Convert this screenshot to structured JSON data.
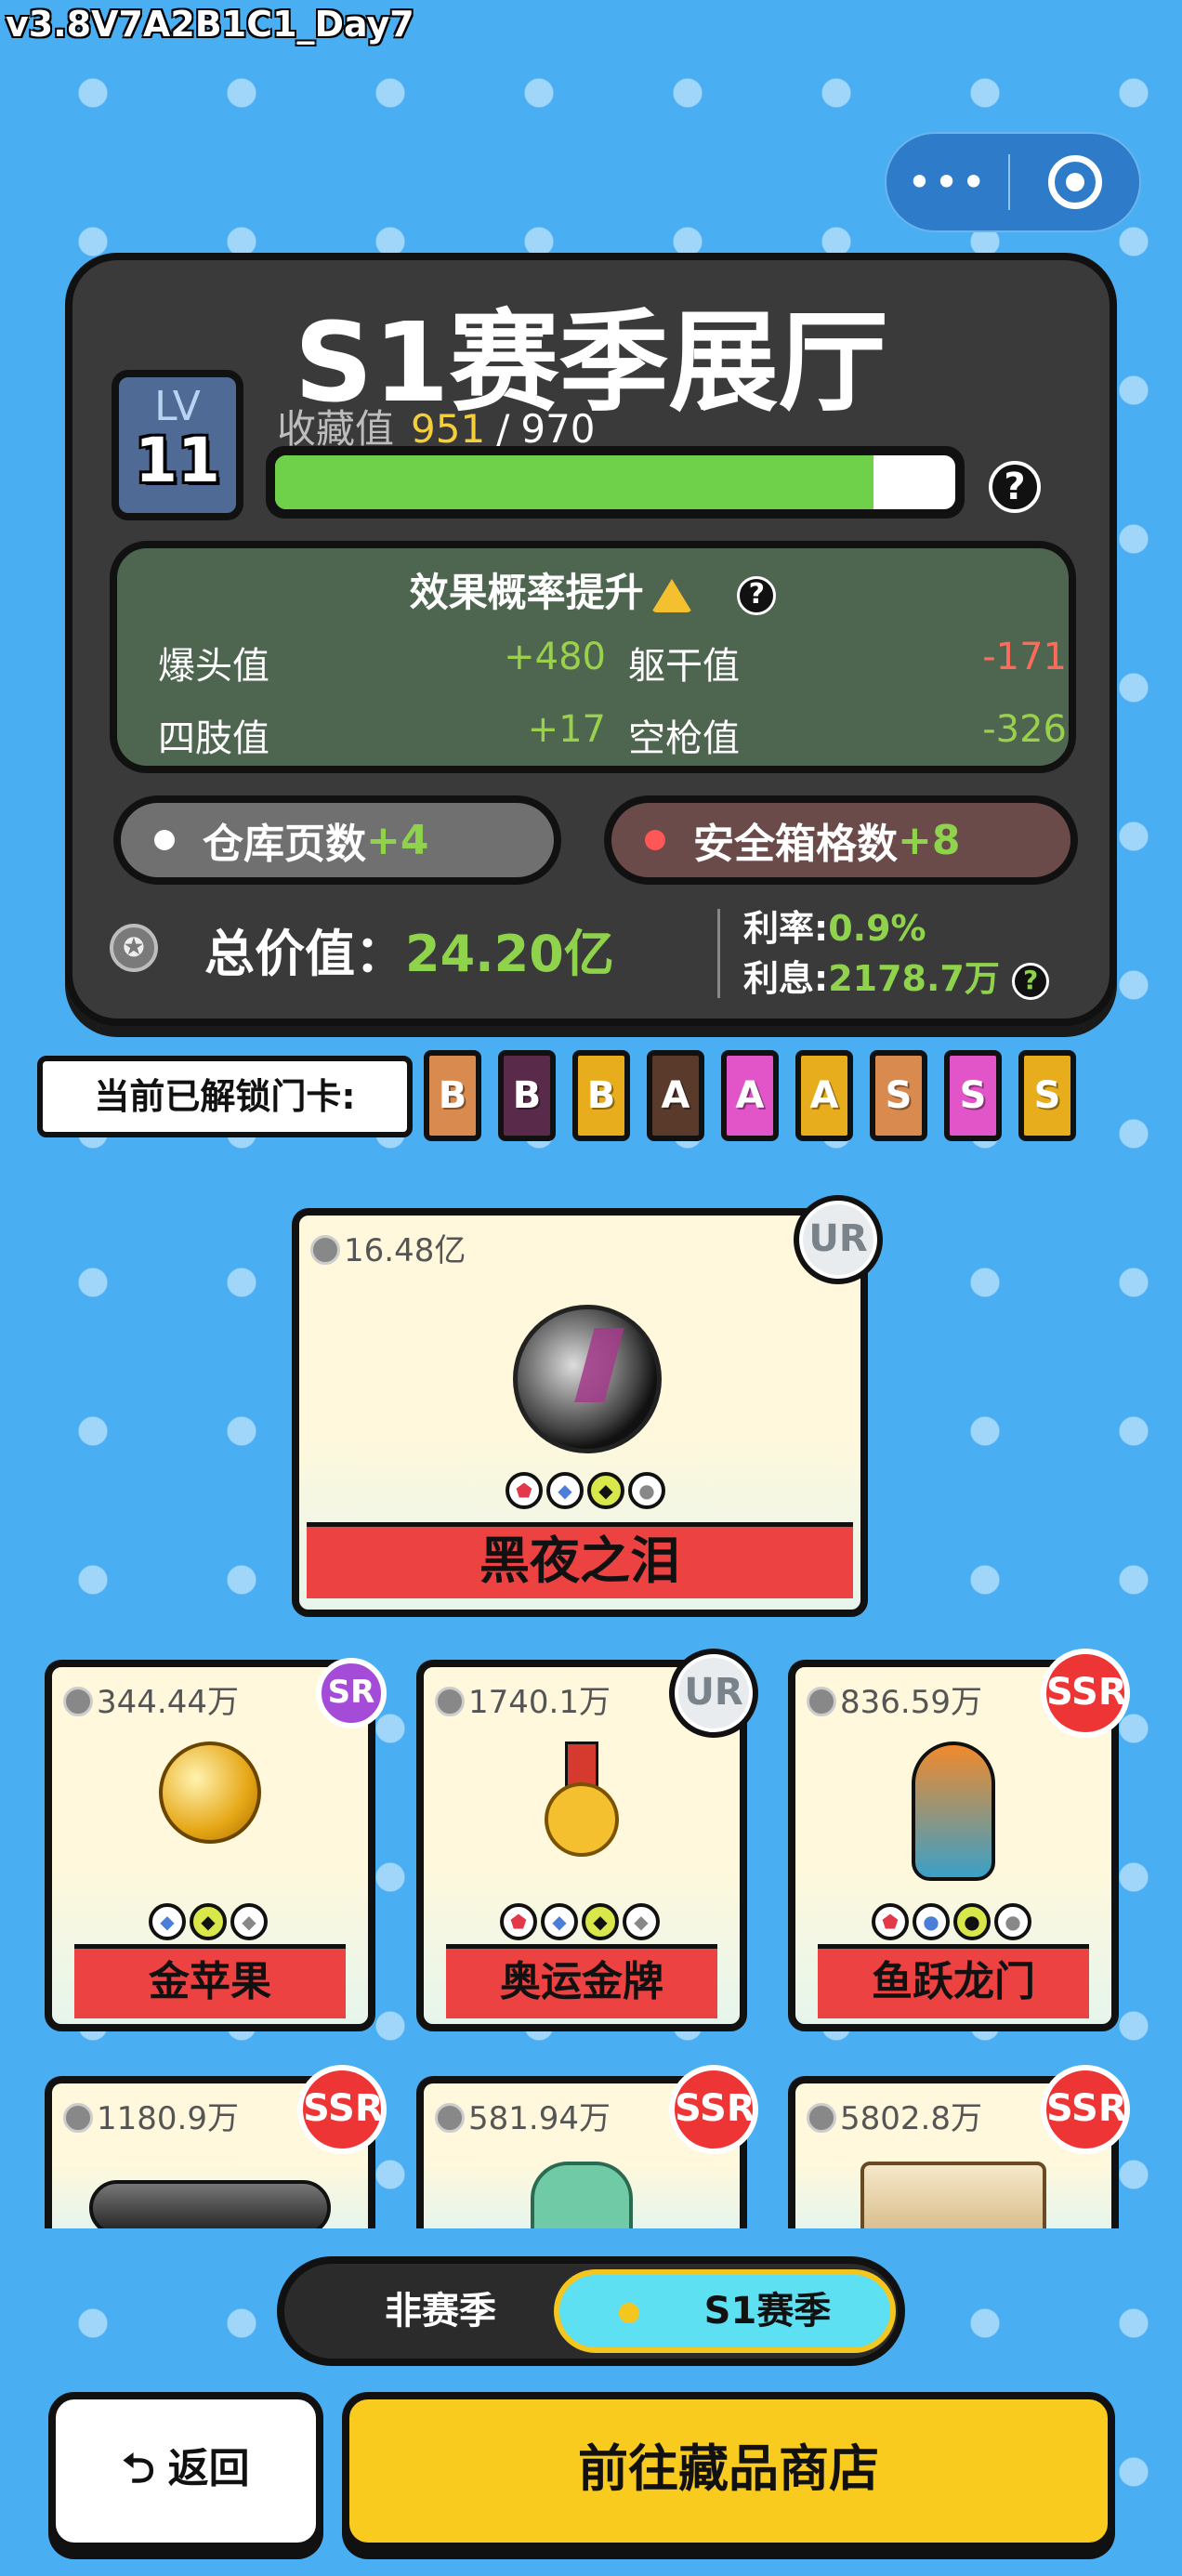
{
  "version": "v3.8V7A2B1C1_Day7",
  "capsule": {
    "more_icon": "more-dots-icon",
    "close_icon": "target-ring-icon"
  },
  "hall": {
    "title": "S1赛季展厅",
    "lv_label": "LV",
    "lv_value": "11",
    "collection_label": "收藏值",
    "collection_current": "951",
    "collection_slash": "/",
    "collection_max": "970",
    "collection_progress": 0.88,
    "help": "?"
  },
  "effect": {
    "title": "效果概率提升",
    "help": "?",
    "stats": [
      {
        "label": "爆头值",
        "value": "+480",
        "sign": "pos"
      },
      {
        "label": "躯干值",
        "value": "-171",
        "sign": "neg"
      },
      {
        "label": "四肢值",
        "value": "+17",
        "sign": "pos"
      },
      {
        "label": "空枪值",
        "value": "-326",
        "sign": "pos"
      }
    ]
  },
  "bonus": {
    "warehouse_label": "仓库页数",
    "warehouse_value": "+4",
    "safebox_label": "安全箱格数",
    "safebox_value": "+8"
  },
  "total": {
    "label": "总价值：",
    "value": "24.20亿",
    "rate_label": "利率:",
    "rate_value": "0.9%",
    "interest_label": "利息:",
    "interest_value": "2178.7万",
    "help": "?"
  },
  "unlock": {
    "label": "当前已解锁门卡:",
    "cards": [
      {
        "text": "B",
        "color": "#d98a4e"
      },
      {
        "text": "B",
        "color": "#5a2a4a"
      },
      {
        "text": "B",
        "color": "#e8ad1c"
      },
      {
        "text": "A",
        "color": "#5a3a2a"
      },
      {
        "text": "A",
        "color": "#e255c8"
      },
      {
        "text": "A",
        "color": "#e8ad1c"
      },
      {
        "text": "S",
        "color": "#d98a4e"
      },
      {
        "text": "S",
        "color": "#e255c8"
      },
      {
        "text": "S",
        "color": "#e8ad1c"
      }
    ]
  },
  "featured": {
    "price": "16.48亿",
    "rarity": "UR",
    "name": "黑夜之泪",
    "icon": "black-orb-icon"
  },
  "items": [
    {
      "price": "344.44万",
      "rarity": "SR",
      "name": "金苹果",
      "icon": "golden-apple-icon"
    },
    {
      "price": "1740.1万",
      "rarity": "UR",
      "name": "奥运金牌",
      "icon": "gold-medal-icon"
    },
    {
      "price": "836.59万",
      "rarity": "SSR",
      "name": "鱼跃龙门",
      "icon": "koi-fish-icon"
    },
    {
      "price": "1180.9万",
      "rarity": "SSR",
      "name": "",
      "icon": "telescope-icon"
    },
    {
      "price": "581.94万",
      "rarity": "SSR",
      "name": "",
      "icon": "jade-horse-icon"
    },
    {
      "price": "5802.8万",
      "rarity": "SSR",
      "name": "",
      "icon": "sailing-ship-icon"
    }
  ],
  "tabs": {
    "off": "非赛季",
    "on": "S1赛季"
  },
  "buttons": {
    "back": "返回",
    "shop": "前往藏品商店"
  }
}
